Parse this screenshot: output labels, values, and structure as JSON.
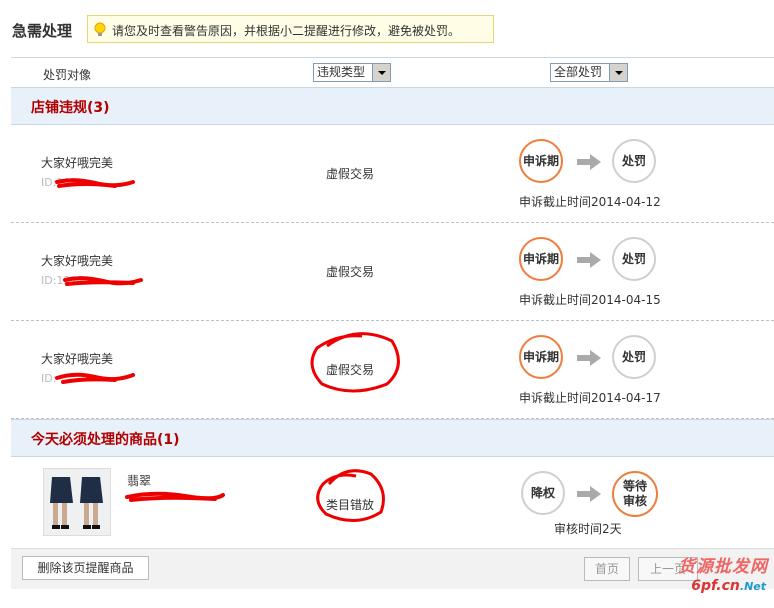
{
  "header": {
    "title": "急需处理",
    "tip": "请您及时查看警告原因，并根据小二提醒进行修改，避免被处罚。"
  },
  "filters": {
    "object_label": "处罚对像",
    "violation_type": "违规类型",
    "punishment": "全部处罚"
  },
  "store_section": {
    "title": "店铺违规(3)",
    "rows": [
      {
        "name": "大家好哦完美",
        "id_prefix": "ID:102",
        "type": "虚假交易",
        "step1": "申诉期",
        "step2": "处罚",
        "deadline": "申诉截止时间2014-04-12"
      },
      {
        "name": "大家好哦完美",
        "id_prefix": "ID:1227",
        "type": "虚假交易",
        "step1": "申诉期",
        "step2": "处罚",
        "deadline": "申诉截止时间2014-04-15"
      },
      {
        "name": "大家好哦完美",
        "id_prefix": "ID:",
        "type": "虚假交易",
        "step1": "申诉期",
        "step2": "处罚",
        "deadline": "申诉截止时间2014-04-17"
      }
    ]
  },
  "goods_section": {
    "title": "今天必须处理的商品(1)",
    "rows": [
      {
        "name": "翡翠",
        "type": "类目错放",
        "step1": "降权",
        "step2": "等待审核",
        "deadline": "审核时间2天"
      }
    ]
  },
  "footer": {
    "delete_button": "删除该页提醒商品",
    "first_page": "首页",
    "prev_page": "上一页"
  },
  "watermark": {
    "text": "货源批发网",
    "url": "6pf.cn",
    "tld": ".Net"
  },
  "colors": {
    "accent_red": "#b00000",
    "step_orange": "#ef7d3c",
    "section_bg": "#e8f0f9"
  }
}
